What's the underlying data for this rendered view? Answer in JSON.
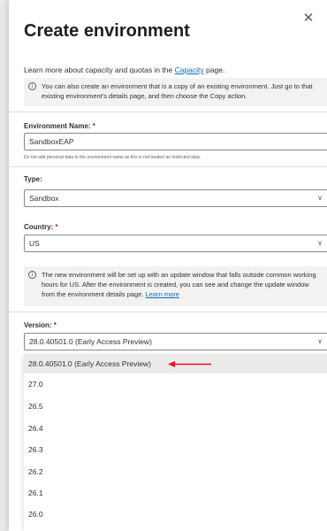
{
  "panel": {
    "close_icon": "close-icon",
    "title": "Create environment",
    "learn_prefix": "Learn more about capacity and quotas in the ",
    "learn_link": "Capacity",
    "learn_suffix": " page."
  },
  "copy_info": {
    "icon": "info-icon",
    "text": "You can also create an environment that is a copy of an existing environment. Just go to that existing environment's details page, and then choose the Copy action."
  },
  "environment_name": {
    "label": "Environment Name:",
    "required": " *",
    "value": "SandboxEAP",
    "hint": "Do not add personal data to the environment name as this is not treated as restricted data."
  },
  "type": {
    "label": "Type:",
    "value": "Sandbox"
  },
  "country": {
    "label": "Country:",
    "required": " *",
    "value": "US"
  },
  "update_info": {
    "icon": "info-icon",
    "text": "The new environment will be set up with an update window that falls outside common working hours for US. After the environment is created, you can see and change the update window from the environment details page. ",
    "link": "Learn more"
  },
  "version": {
    "label": "Version:",
    "required": " *",
    "value": "28.0.40501.0 (Early Access Preview)",
    "options": [
      "28.0.40501.0 (Early Access Preview)",
      "27.0",
      "26.5",
      "26.4",
      "26.3",
      "26.2",
      "26.1",
      "26.0"
    ]
  },
  "colors": {
    "accent": "#0f6cbd",
    "required": "#a4262c",
    "annotation_arrow": "#e81123"
  }
}
